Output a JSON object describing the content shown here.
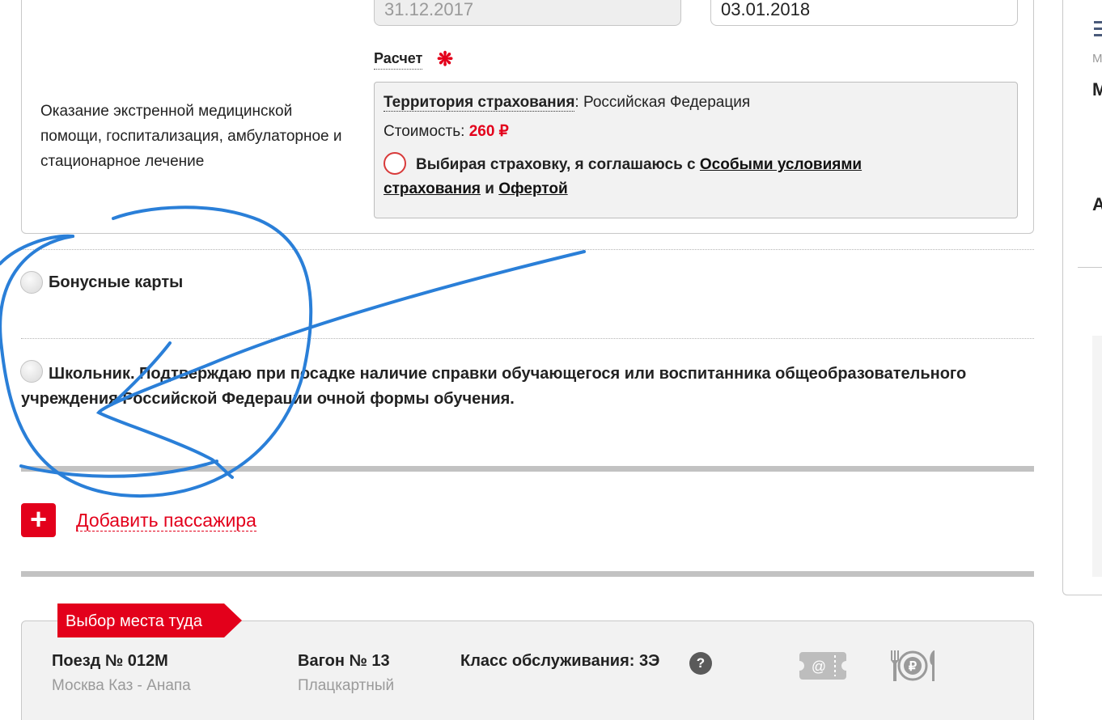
{
  "insurance": {
    "date_from": "31.12.2017",
    "date_to": "03.01.2018",
    "calc_label": "Расчет",
    "required_mark": "❋",
    "description": "Оказание экстренной медицинской помощи, госпитализация, амбулаторное и стационарное лечение",
    "territory_key": "Территория страхования",
    "territory_value": ": Российская Федерация",
    "cost_label": "Стоимость: ",
    "cost_value": "260 ₽",
    "agree_prefix": "Выбирая страховку, я соглашаюсь с ",
    "agree_link_conditions": "Особыми условиями страхования",
    "agree_and": " и ",
    "agree_link_offer": "Офертой"
  },
  "options": {
    "bonus_cards_label": "Бонусные карты",
    "schoolchild_label": "Школьник. Подтверждаю при посадке наличие справки обучающегося или воспитанника общеобразовательного учреждения Российской Федерации очной формы обучения."
  },
  "add_passenger": {
    "icon": "plus-icon",
    "label": "Добавить пассажира"
  },
  "seat_selection": {
    "tag": "Выбор места туда",
    "train_title": "Поезд № 012М",
    "train_route": "Москва Каз - Анапа",
    "car_title": "Вагон № 13",
    "car_type": "Плацкартный",
    "class_title": "Класс обслуживания: 3Э",
    "help_mark": "?",
    "eticket_mark": "@",
    "icons": [
      "help-icon",
      "e-ticket-icon",
      "meal-icon"
    ]
  },
  "sidebar": {
    "small_letter": "М",
    "big_letter": "М",
    "letter_a": "А"
  },
  "colors": {
    "accent_red": "#e3001b",
    "annotation_blue": "#2a7fd8",
    "panel_gray": "#f2f2f2"
  }
}
